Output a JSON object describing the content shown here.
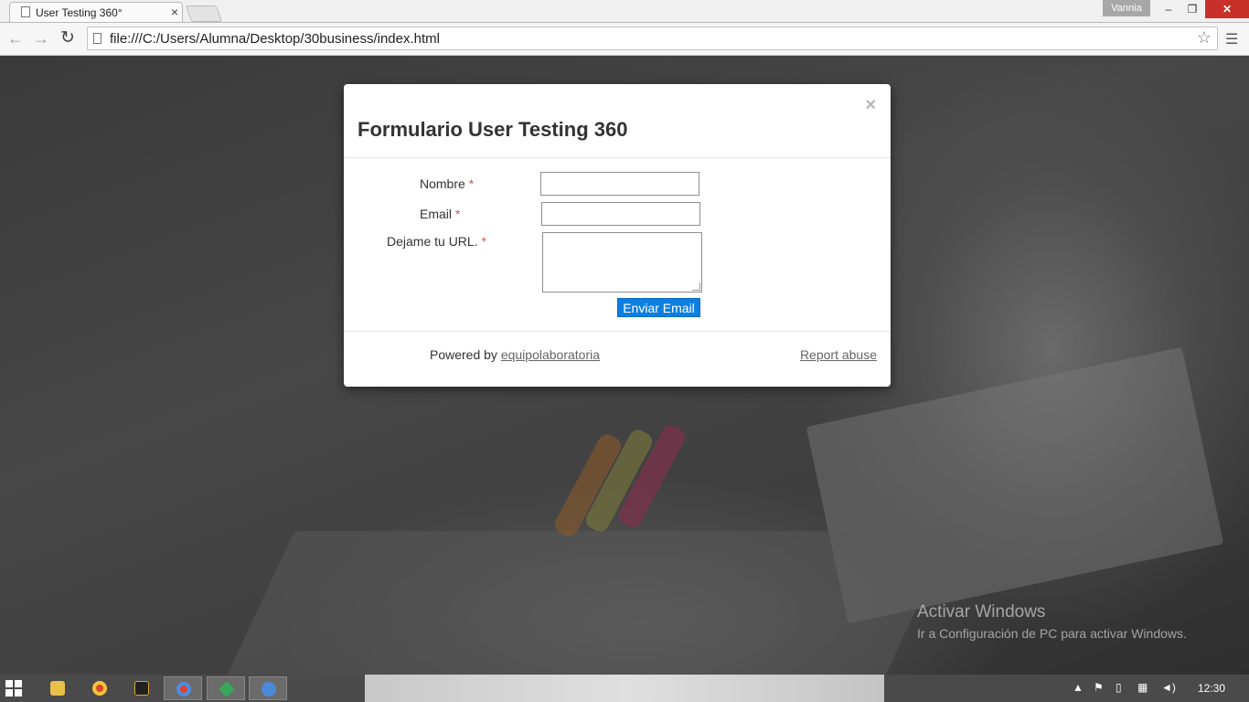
{
  "browser": {
    "tab_title": "User Testing 360°",
    "tab_close": "×",
    "profile_name": "Vannia",
    "url": "file:///C:/Users/Alumna/Desktop/30business/index.html",
    "minimize_glyph": "–",
    "maximize_glyph": "❐",
    "close_glyph": "✕",
    "back_glyph": "←",
    "forward_glyph": "→",
    "reload_glyph": "↻",
    "star_glyph": "☆",
    "menu_glyph": "☰"
  },
  "modal": {
    "close_glyph": "×",
    "title": "Formulario User Testing 360",
    "fields": {
      "nombre_label": "Nombre",
      "email_label": "Email",
      "url_label": "Dejame tu URL.",
      "required_mark": "*",
      "nombre_value": "",
      "email_value": "",
      "url_value": ""
    },
    "submit_label": "Enviar Email",
    "footer": {
      "powered_prefix": "Powered by",
      "powered_link": "equipolaboratoria",
      "report_abuse": "Report abuse"
    },
    "accent_color": "#0d7fe0"
  },
  "watermark": {
    "line1": "Activar Windows",
    "line2": "Ir a Configuración de PC para activar Windows."
  },
  "taskbar": {
    "items": [
      "file-explorer-icon",
      "chrome-icon",
      "slides-icon",
      "chrome-canary-icon",
      "git-icon",
      "app-icon"
    ],
    "tray_icons": [
      "up-arrow-icon",
      "flag-icon",
      "device-icon",
      "network-icon",
      "volume-icon"
    ],
    "clock": "12:30"
  }
}
